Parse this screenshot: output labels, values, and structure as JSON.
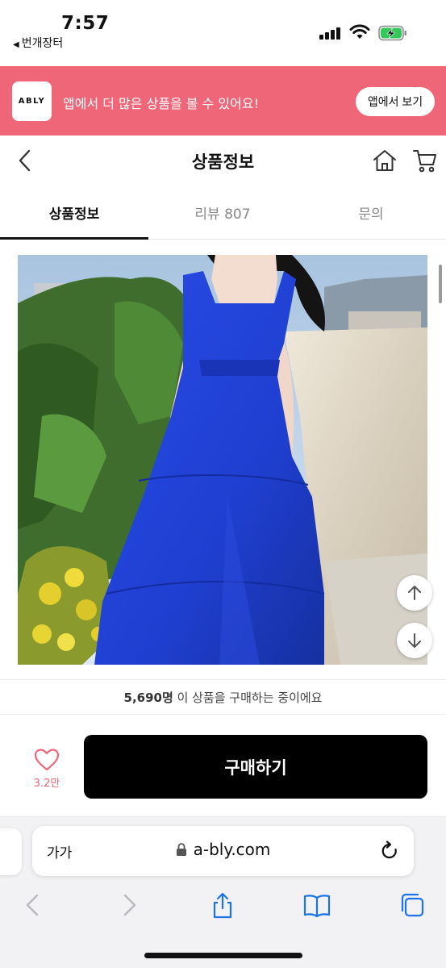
{
  "status_bar": {
    "time": "7:57",
    "back_app": "번개장터"
  },
  "app_banner": {
    "logo_text": "ABLY",
    "message": "앱에서 더 많은 상품을 볼 수 있어요!",
    "button_label": "앱에서 보기",
    "background_color": "#ee6677"
  },
  "header": {
    "title": "상품정보"
  },
  "tabs": [
    {
      "label": "상품정보",
      "active": true
    },
    {
      "label": "리뷰 807",
      "active": false
    },
    {
      "label": "문의",
      "active": false
    }
  ],
  "product": {
    "dress_color": "#1f3fd1"
  },
  "purchase_info": {
    "count": "5,690명",
    "text": "이 상품을 구매하는 중이에요"
  },
  "action_bar": {
    "like_count": "3.2만",
    "buy_label": "구매하기"
  },
  "browser": {
    "aa_label": "가가",
    "url": "a-bly.com"
  }
}
